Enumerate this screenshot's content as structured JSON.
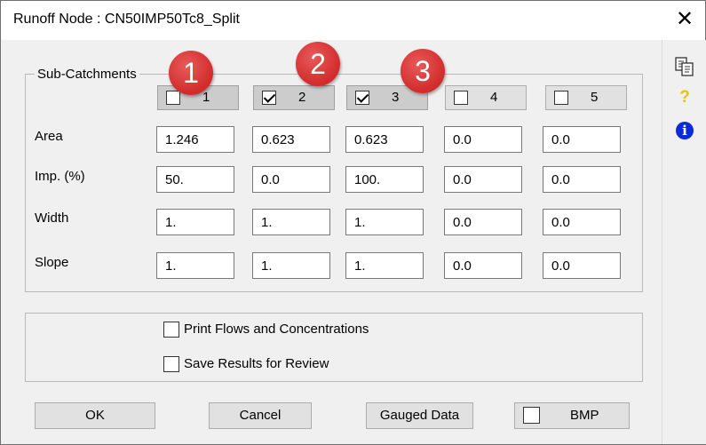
{
  "window": {
    "title": "Runoff Node : CN50IMP50Tc8_Split",
    "close_glyph": "✕"
  },
  "subcatchments": {
    "legend": "Sub-Catchments",
    "columns": [
      {
        "label": "1",
        "checked": false,
        "badge": "1"
      },
      {
        "label": "2",
        "checked": true,
        "badge": "2"
      },
      {
        "label": "3",
        "checked": true,
        "badge": "3"
      },
      {
        "label": "4",
        "checked": false,
        "badge": ""
      },
      {
        "label": "5",
        "checked": false,
        "badge": ""
      }
    ],
    "rows": [
      {
        "label": "Area",
        "values": [
          "1.246",
          "0.623",
          "0.623",
          "0.0",
          "0.0"
        ]
      },
      {
        "label": "Imp. (%)",
        "values": [
          "50.",
          "0.0",
          "100.",
          "0.0",
          "0.0"
        ]
      },
      {
        "label": "Width",
        "values": [
          "1.",
          "1.",
          "1.",
          "0.0",
          "0.0"
        ]
      },
      {
        "label": "Slope",
        "values": [
          "1.",
          "1.",
          "1.",
          "0.0",
          "0.0"
        ]
      }
    ]
  },
  "options": {
    "print_flows": "Print Flows and Concentrations",
    "save_results": "Save Results for Review"
  },
  "buttons": {
    "ok": "OK",
    "cancel": "Cancel",
    "gauged": "Gauged Data",
    "bmp": "BMP"
  },
  "rail": {
    "copy_icon": "copy-icon",
    "help_glyph": "?",
    "info_glyph": "i",
    "help_color": "#e6c600",
    "info_color": "#0a2bd8"
  },
  "badge_color": "#d22b2b"
}
